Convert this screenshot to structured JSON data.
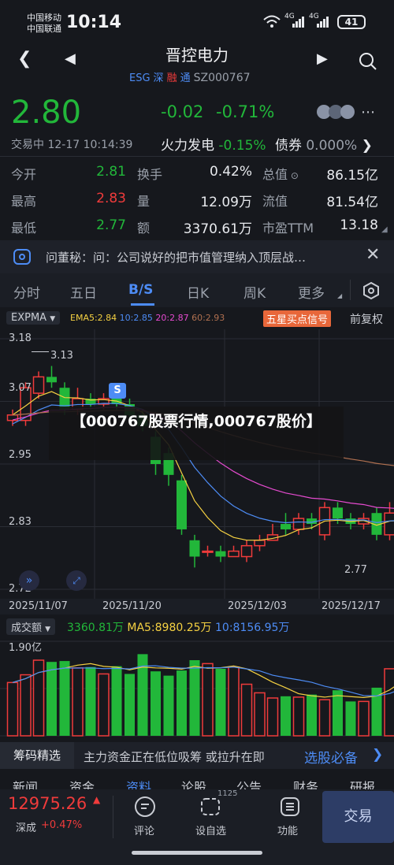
{
  "status_bar": {
    "carrier_1": "中国移动",
    "carrier_2": "中国联通",
    "time": "10:14",
    "signal_1": "4G",
    "signal_2": "4G",
    "battery": "41"
  },
  "header": {
    "title": "晋控电力",
    "tags": [
      "ESG",
      "深",
      "融",
      "通"
    ],
    "code": "SZ000767"
  },
  "quote": {
    "price": "2.80",
    "change": "-0.02",
    "change_pct": "-0.71%",
    "status": "交易中 12-17 10:14:39",
    "sector": "火力发电",
    "sector_pct": "-0.15%",
    "bond_label": "债券",
    "bond_value": "0.000%",
    "rows": [
      {
        "l1": "今开",
        "v1": "2.81",
        "l2": "换手",
        "v2": "0.42%",
        "l3": "总值",
        "v3": "86.15亿"
      },
      {
        "l1": "最高",
        "v1": "2.83",
        "l2": "量",
        "v2": "12.09万",
        "l3": "流值",
        "v3": "81.54亿"
      },
      {
        "l1": "最低",
        "v1": "2.77",
        "l2": "额",
        "v2": "3370.61万",
        "l3": "市盈TTM",
        "v3": "13.18"
      }
    ]
  },
  "notice": {
    "text": "问董秘：问：公司说好的把市值管理纳入顶层战…"
  },
  "tabs": [
    "分时",
    "五日",
    "B/S",
    "日K",
    "周K",
    "更多"
  ],
  "chart_toolbar": {
    "indicator": "EXPMA",
    "ema5": "EMA5:2.84",
    "ema10": "10:2.85",
    "ema20": "20:2.87",
    "ema60": "60:2.93",
    "signal_button": "五星买点信号",
    "adjust": "前复权"
  },
  "chart_labels": {
    "y_ticks": [
      "3.18",
      "3.07",
      "2.95",
      "2.83",
      "2.72"
    ],
    "high_label": "3.13",
    "low_label": "2.77",
    "s_marker": "S",
    "dates": [
      "2025/11/07",
      "2025/11/20",
      "2025/12/03",
      "2025/12/17"
    ]
  },
  "overlay": {
    "text": "【000767股票行情,000767股价】"
  },
  "volume_toolbar": {
    "indicator": "成交额",
    "value": "3360.81万",
    "ma5": "MA5:8980.25万",
    "ma10": "10:8156.95万",
    "y_top": "1.90亿"
  },
  "promo": {
    "label": "筹码精选",
    "text": "主力资金正在低位吸筹 或拉升在即",
    "link": "选股必备"
  },
  "bottom_tabs": [
    "新闻",
    "资金",
    "资料",
    "论股",
    "公告",
    "财务",
    "研报"
  ],
  "footer": {
    "index_value": "12975.26",
    "index_name": "深成",
    "index_pct": "+0.47%",
    "comment": "评论",
    "watchlist": "设自选",
    "watch_count": "1125",
    "functions": "功能",
    "trade": "交易"
  },
  "chart_data": {
    "type": "candlestick",
    "ylim": [
      2.72,
      3.18
    ],
    "candles": [
      {
        "o": 3.03,
        "c": 3.04,
        "h": 3.05,
        "l": 3.02
      },
      {
        "o": 3.03,
        "c": 3.09,
        "h": 3.1,
        "l": 3.02
      },
      {
        "o": 3.08,
        "c": 3.11,
        "h": 3.12,
        "l": 3.07
      },
      {
        "o": 3.11,
        "c": 3.1,
        "h": 3.13,
        "l": 3.09
      },
      {
        "o": 3.09,
        "c": 3.05,
        "h": 3.1,
        "l": 3.04
      },
      {
        "o": 3.05,
        "c": 3.07,
        "h": 3.09,
        "l": 3.04
      },
      {
        "o": 3.07,
        "c": 3.06,
        "h": 3.08,
        "l": 3.05
      },
      {
        "o": 3.06,
        "c": 3.07,
        "h": 3.08,
        "l": 3.05
      },
      {
        "o": 3.07,
        "c": 3.06,
        "h": 3.08,
        "l": 3.05
      },
      {
        "o": 3.06,
        "c": 3.04,
        "h": 3.07,
        "l": 3.03
      },
      {
        "o": 3.04,
        "c": 3.02,
        "h": 3.05,
        "l": 3.01
      },
      {
        "o": 3.0,
        "c": 2.95,
        "h": 3.01,
        "l": 2.93
      },
      {
        "o": 2.97,
        "c": 2.93,
        "h": 2.98,
        "l": 2.91
      },
      {
        "o": 2.92,
        "c": 2.83,
        "h": 2.93,
        "l": 2.82
      },
      {
        "o": 2.81,
        "c": 2.78,
        "h": 2.82,
        "l": 2.76
      },
      {
        "o": 2.79,
        "c": 2.79,
        "h": 2.8,
        "l": 2.78
      },
      {
        "o": 2.79,
        "c": 2.78,
        "h": 2.8,
        "l": 2.77
      },
      {
        "o": 2.78,
        "c": 2.79,
        "h": 2.8,
        "l": 2.78
      },
      {
        "o": 2.78,
        "c": 2.8,
        "h": 2.81,
        "l": 2.77
      },
      {
        "o": 2.8,
        "c": 2.81,
        "h": 2.82,
        "l": 2.79
      },
      {
        "o": 2.81,
        "c": 2.82,
        "h": 2.84,
        "l": 2.81
      },
      {
        "o": 2.84,
        "c": 2.83,
        "h": 2.86,
        "l": 2.82
      },
      {
        "o": 2.83,
        "c": 2.85,
        "h": 2.86,
        "l": 2.82
      },
      {
        "o": 2.85,
        "c": 2.84,
        "h": 2.86,
        "l": 2.83
      },
      {
        "o": 2.82,
        "c": 2.87,
        "h": 2.88,
        "l": 2.81
      },
      {
        "o": 2.87,
        "c": 2.85,
        "h": 2.88,
        "l": 2.84
      },
      {
        "o": 2.85,
        "c": 2.84,
        "h": 2.86,
        "l": 2.83
      },
      {
        "o": 2.84,
        "c": 2.85,
        "h": 2.86,
        "l": 2.83
      },
      {
        "o": 2.86,
        "c": 2.82,
        "h": 2.87,
        "l": 2.81
      },
      {
        "o": 2.82,
        "c": 2.86,
        "h": 2.88,
        "l": 2.81
      },
      {
        "o": 2.86,
        "c": 2.85,
        "h": 2.88,
        "l": 2.84
      },
      {
        "o": 2.86,
        "c": 2.81,
        "h": 2.87,
        "l": 2.8
      },
      {
        "o": 2.8,
        "c": 2.79,
        "h": 2.82,
        "l": 2.77
      }
    ],
    "volume": [
      62,
      71,
      88,
      86,
      87,
      79,
      80,
      72,
      81,
      72,
      95,
      75,
      70,
      76,
      88,
      84,
      78,
      80,
      60,
      50,
      44,
      46,
      45,
      48,
      42,
      53,
      40,
      40,
      56,
      78,
      105,
      95,
      20
    ]
  }
}
